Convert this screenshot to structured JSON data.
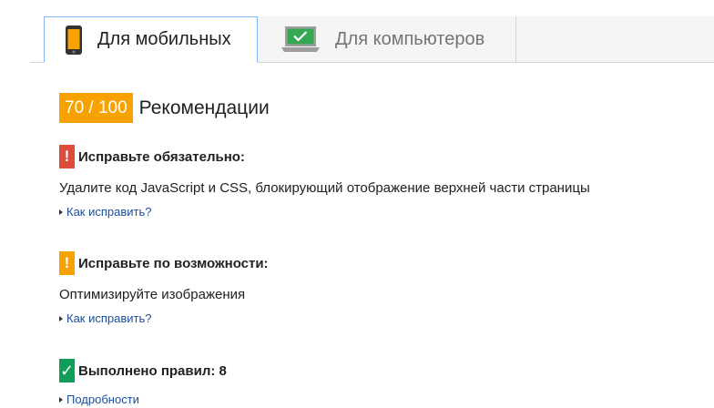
{
  "tabs": {
    "mobile": {
      "label": "Для мобильных",
      "icon": "phone-icon",
      "active": true
    },
    "desktop": {
      "label": "Для компьютеров",
      "icon": "laptop-icon",
      "active": false
    }
  },
  "score": {
    "value": "70 / 100",
    "label": "Рекомендации",
    "color": "#f8a200"
  },
  "sections": {
    "must_fix": {
      "flag": "!",
      "title": "Исправьте обязательно:",
      "rule": "Удалите код JavaScript и CSS, блокирующий отображение верхней части страницы",
      "link": "Как исправить?",
      "color": "#dd4b39"
    },
    "should_fix": {
      "flag": "!",
      "title": "Исправьте по возможности:",
      "rule": "Оптимизируйте изображения",
      "link": "Как исправить?",
      "color": "#f8a200"
    },
    "passed": {
      "flag": "✓",
      "title": "Выполнено правил: 8",
      "link": "Подробности",
      "color": "#0f9d58"
    }
  },
  "colors": {
    "link": "#1a4f9c",
    "active_tab_border": "#8ab4f8"
  }
}
